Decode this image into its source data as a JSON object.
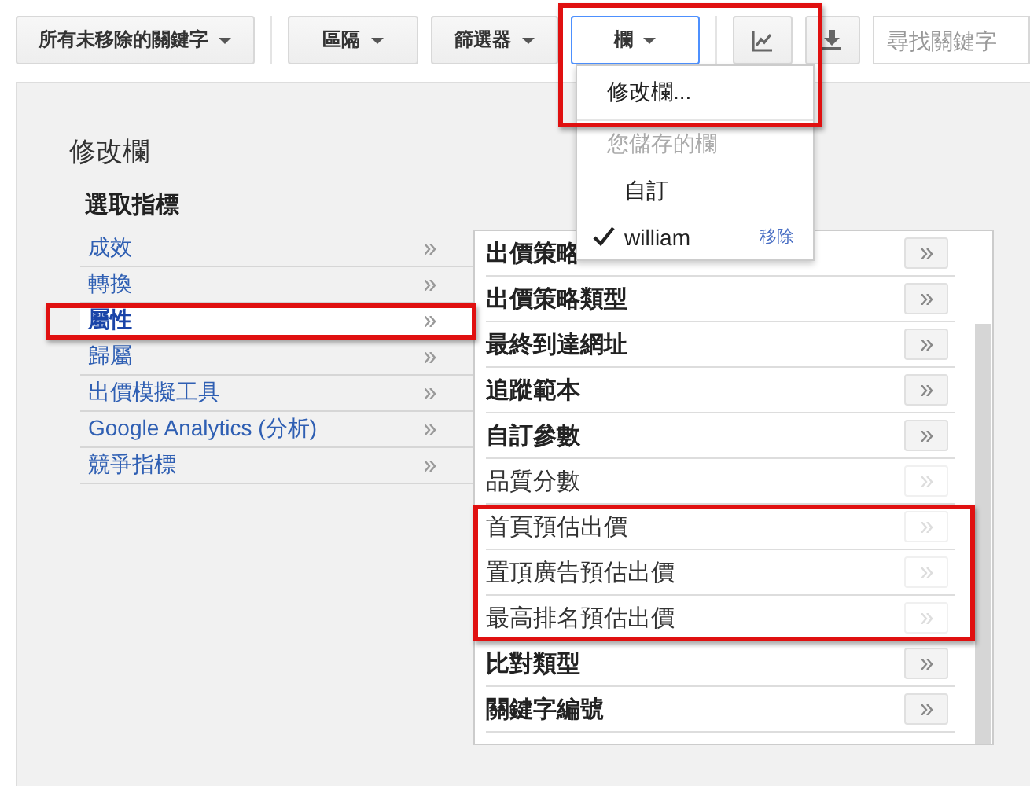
{
  "toolbar": {
    "buttons": [
      {
        "kind": "dropdown",
        "label": "所有未移除的關鍵字",
        "selected": false,
        "highlighted": false
      },
      {
        "kind": "dropdown",
        "label": "區隔",
        "selected": false,
        "highlighted": false
      },
      {
        "kind": "dropdown",
        "label": "篩選器",
        "selected": false,
        "highlighted": false
      },
      {
        "kind": "dropdown",
        "label": "欄",
        "selected": true,
        "highlighted": true
      },
      {
        "kind": "chart",
        "selected": false,
        "highlighted": false
      },
      {
        "kind": "download",
        "selected": false,
        "highlighted": false
      }
    ],
    "search": {
      "placeholder": "尋找關鍵字"
    }
  },
  "columns_menu": {
    "items": [
      {
        "kind": "action",
        "label": "修改欄...",
        "highlighted": true
      },
      {
        "kind": "header",
        "label": "您儲存的欄"
      },
      {
        "kind": "saved",
        "label": "自訂",
        "checked": false
      },
      {
        "kind": "saved",
        "label": "william",
        "checked": true,
        "action": "移除"
      }
    ]
  },
  "editor": {
    "title": "修改欄",
    "subtitle": "選取指標",
    "categories": [
      {
        "label": "成效",
        "selected": false,
        "highlighted": false
      },
      {
        "label": "轉換",
        "selected": false,
        "highlighted": false
      },
      {
        "label": "屬性",
        "selected": true,
        "highlighted": true
      },
      {
        "label": "歸屬",
        "selected": false,
        "highlighted": false
      },
      {
        "label": "出價模擬工具",
        "selected": false,
        "highlighted": false
      },
      {
        "label": "Google Analytics (分析)",
        "selected": false,
        "highlighted": false
      },
      {
        "label": "競爭指標",
        "selected": false,
        "highlighted": false
      }
    ],
    "metrics": [
      {
        "label": "出價策略",
        "disabled": false,
        "highlighted": false
      },
      {
        "label": "出價策略類型",
        "disabled": false,
        "highlighted": false
      },
      {
        "label": "最終到達網址",
        "disabled": false,
        "highlighted": false
      },
      {
        "label": "追蹤範本",
        "disabled": false,
        "highlighted": false
      },
      {
        "label": "自訂參數",
        "disabled": false,
        "highlighted": false
      },
      {
        "label": "品質分數",
        "disabled": true,
        "highlighted": false
      },
      {
        "label": "首頁預估出價",
        "disabled": true,
        "highlighted": true
      },
      {
        "label": "置頂廣告預估出價",
        "disabled": true,
        "highlighted": true
      },
      {
        "label": "最高排名預估出價",
        "disabled": true,
        "highlighted": true
      },
      {
        "label": "比對類型",
        "disabled": false,
        "highlighted": false
      },
      {
        "label": "關鍵字編號",
        "disabled": false,
        "highlighted": false
      }
    ]
  }
}
